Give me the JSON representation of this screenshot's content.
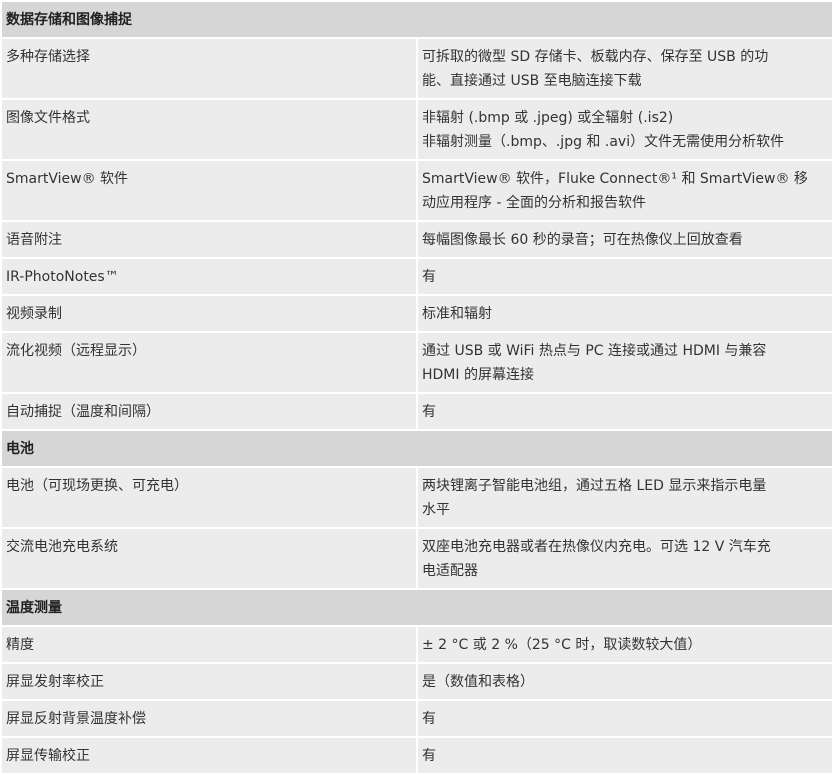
{
  "sections": [
    {
      "title": "数据存储和图像捕捉",
      "rows": [
        {
          "label": "多种存储选择",
          "value": [
            "可拆取的微型 SD 存储卡、板载内存、保存至 USB 的功",
            "能、直接通过 USB 至电脑连接下载"
          ]
        },
        {
          "label": "图像文件格式",
          "value": [
            "非辐射 (.bmp 或 .jpeg) 或全辐射 (.is2)",
            "非辐射测量（.bmp、.jpg 和 .avi）文件无需使用分析软件"
          ]
        },
        {
          "label": "SmartView® 软件",
          "value": [
            "SmartView® 软件，Fluke Connect®¹ 和 SmartView® 移",
            "动应用程序 - 全面的分析和报告软件"
          ]
        },
        {
          "label": "语音附注",
          "value": [
            "每幅图像最长 60 秒的录音；可在热像仪上回放查看"
          ]
        },
        {
          "label": "IR-PhotoNotes™",
          "value": [
            "有"
          ]
        },
        {
          "label": "视频录制",
          "value": [
            "标准和辐射"
          ]
        },
        {
          "label": "流化视频（远程显示）",
          "value": [
            "通过 USB 或 WiFi 热点与 PC 连接或通过 HDMI 与兼容",
            "HDMI 的屏幕连接"
          ]
        },
        {
          "label": "自动捕捉（温度和间隔）",
          "value": [
            "有"
          ]
        }
      ]
    },
    {
      "title": "电池",
      "rows": [
        {
          "label": "电池（可现场更换、可充电）",
          "value": [
            "两块锂离子智能电池组，通过五格 LED 显示来指示电量",
            "水平"
          ]
        },
        {
          "label": "交流电池充电系统",
          "value": [
            "双座电池充电器或者在热像仪内充电。可选 12 V 汽车充",
            "电适配器"
          ]
        }
      ]
    },
    {
      "title": "温度测量",
      "rows": [
        {
          "label": "精度",
          "value": [
            "± 2 °C 或 2 %（25 °C 时，取读数较大值）"
          ]
        },
        {
          "label": "屏显发射率校正",
          "value": [
            "是（数值和表格）"
          ]
        },
        {
          "label": "屏显反射背景温度补偿",
          "value": [
            "有"
          ]
        },
        {
          "label": "屏显传输校正",
          "value": [
            "有"
          ]
        }
      ]
    }
  ]
}
